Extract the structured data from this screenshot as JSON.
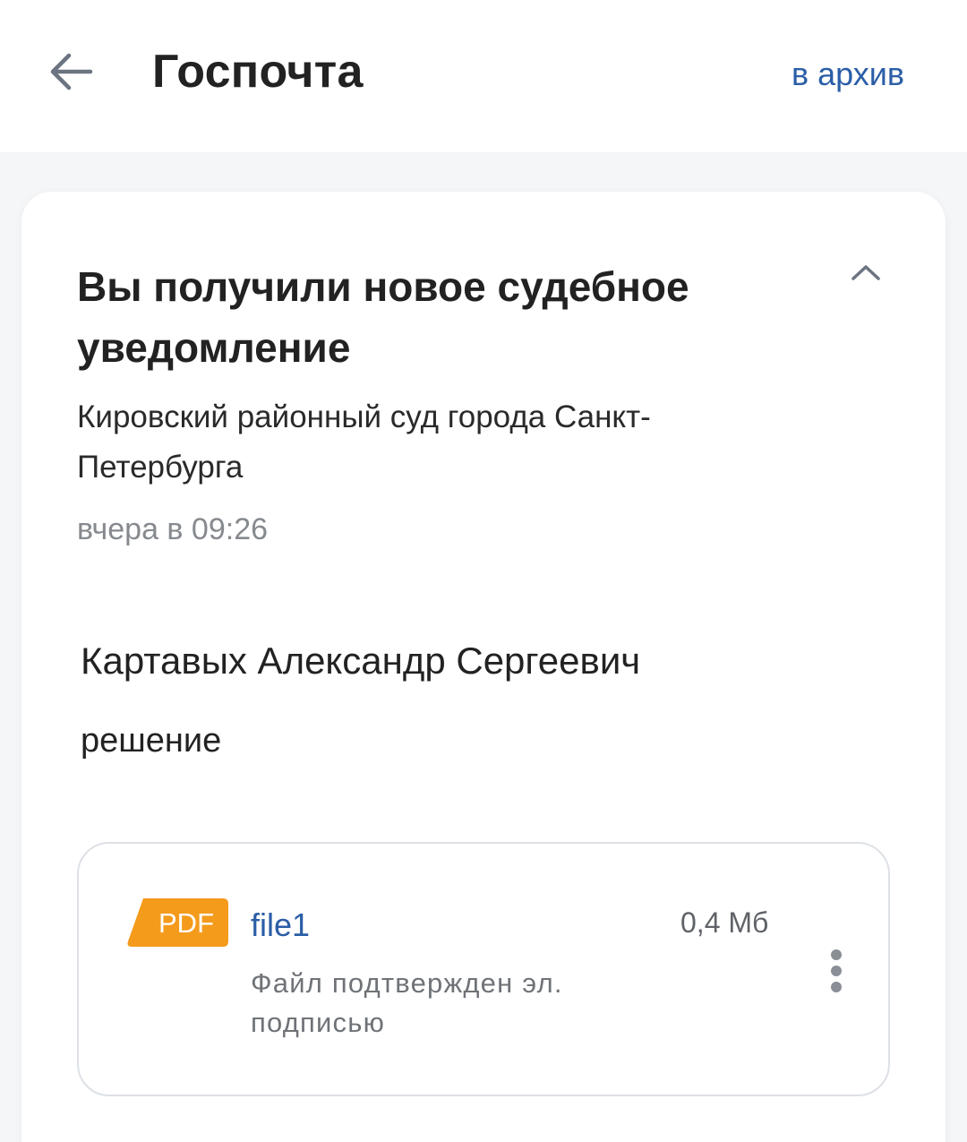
{
  "header": {
    "title": "Госпочта",
    "archive_label": "в архив"
  },
  "notice": {
    "title": "Вы получили новое судебное уведомление",
    "sender": "Кировский районный суд города Санкт-Петербурга",
    "timestamp": "вчера в 09:26",
    "recipient": "Картавых Александр Сергеевич",
    "document_kind": "решение"
  },
  "attachment": {
    "type_label": "PDF",
    "name": "file1",
    "size": "0,4 Мб",
    "status": "Файл подтвержден эл. подписью"
  },
  "icons": {
    "back": "arrow-left-icon",
    "collapse": "chevron-up-icon",
    "more": "more-vertical-icon",
    "pdf": "pdf-file-icon"
  },
  "colors": {
    "accent": "#2b5ea7",
    "pdf_badge": "#f49b1c",
    "muted_text": "#868a8f",
    "background": "#f5f6f8"
  }
}
